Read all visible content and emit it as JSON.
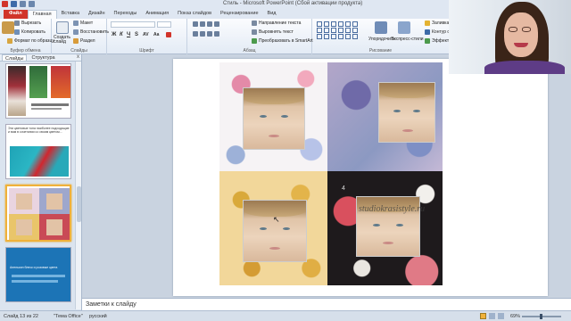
{
  "window": {
    "title": "Стиль - Microsoft PowerPoint (Сбой активации продукта)"
  },
  "tabs": [
    {
      "label": "Файл"
    },
    {
      "label": "Главная"
    },
    {
      "label": "Вставка"
    },
    {
      "label": "Дизайн"
    },
    {
      "label": "Переходы"
    },
    {
      "label": "Анимация"
    },
    {
      "label": "Показ слайдов"
    },
    {
      "label": "Рецензирование"
    },
    {
      "label": "Вид"
    }
  ],
  "ribbon": {
    "clipboard": {
      "name": "Буфер обмена",
      "cut": "Вырезать",
      "copy": "Копировать",
      "format_painter": "Формат по образцу"
    },
    "slides": {
      "name": "Слайды",
      "new_slide": "Создать слайд",
      "layout": "Макет",
      "reset": "Восстановить",
      "section": "Раздел"
    },
    "font": {
      "name": "Шрифт",
      "bold": "Ж",
      "italic": "К",
      "underline": "Ч",
      "strike": "S",
      "spacing": "AV",
      "case": "Aa"
    },
    "paragraph": {
      "name": "Абзац",
      "text_direction": "Направление текста",
      "align_text": "Выровнять текст",
      "smartart": "Преобразовать в SmartArt"
    },
    "drawing": {
      "name": "Рисование",
      "arrange": "Упорядочить",
      "quick_styles": "Экспресс-стили",
      "fill": "Заливка фиг",
      "outline": "Контур фиг",
      "effects": "Эффекты фи"
    }
  },
  "left_pane": {
    "tab_slides": "Слайды",
    "tab_outline": "Структура",
    "close": "x",
    "slides": [
      {
        "number": "",
        "caption": ""
      },
      {
        "number": "",
        "caption": "Эти цветовые тона наиболее подходящие и вам в сочетании со своим цветом..."
      },
      {
        "number": "",
        "caption": ""
      },
      {
        "number": "",
        "caption": "Апельсин блеск и розовые цвета"
      }
    ]
  },
  "slide": {
    "watermark": "studiokrasistyle.ru",
    "number_marker": "4"
  },
  "notes": {
    "placeholder": "Заметки к слайду"
  },
  "status": {
    "slide_counter": "Слайд 13 из 22",
    "theme": "\"Тема Office\"",
    "language": "русский",
    "zoom": "69%"
  },
  "colors": {
    "accent": "#d1342a",
    "ribbon": "#e3ebf5",
    "selected_slide": "#f0b13a"
  }
}
